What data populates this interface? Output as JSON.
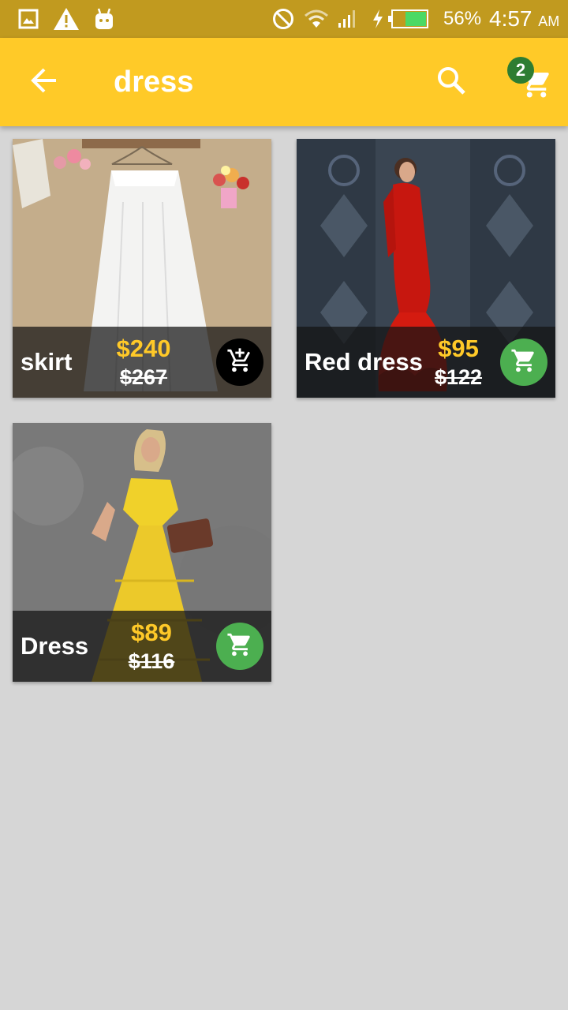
{
  "status_bar": {
    "battery": "56%",
    "time": "4:57",
    "ampm": "AM",
    "icons": [
      "image-icon",
      "warning-icon",
      "android-icon",
      "do-not-disturb-icon",
      "wifi-icon",
      "signal-icon",
      "charging-icon",
      "battery-icon"
    ],
    "battery_color": "#4cd964"
  },
  "app_bar": {
    "title": "dress",
    "cart_count": "2",
    "color": "#ffca28",
    "badge_color": "#2e7d32"
  },
  "products": [
    {
      "name": "skirt",
      "price": "$240",
      "old_price": "$267",
      "cart_icon": "add-shopping-cart-icon",
      "button_color": "#000000"
    },
    {
      "name": "Red dress",
      "price": "$95",
      "old_price": "$122",
      "cart_icon": "shopping-cart-icon",
      "button_color": "#4caf50"
    },
    {
      "name": "Dress",
      "price": "$89",
      "old_price": "$116",
      "cart_icon": "shopping-cart-icon",
      "button_color": "#4caf50"
    }
  ]
}
